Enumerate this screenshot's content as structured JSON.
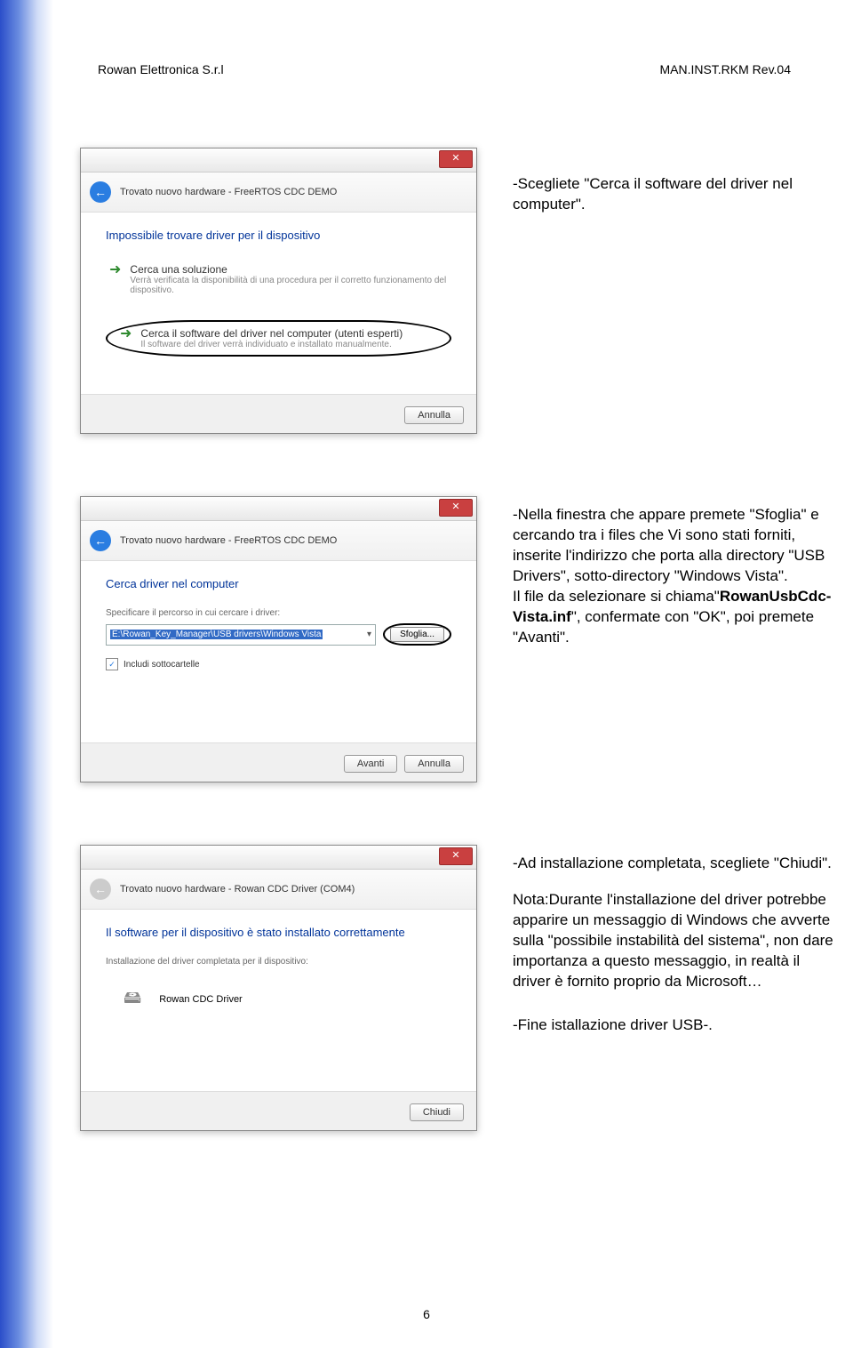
{
  "header": {
    "left": "Rowan Elettronica S.r.l",
    "right": "MAN.INST.RKM    Rev.04"
  },
  "section1": {
    "text": "-Scegliete \"Cerca il software del driver nel computer\".",
    "window": {
      "header_text": "Trovato nuovo hardware - FreeRTOS CDC DEMO",
      "title": "Impossibile trovare driver per il dispositivo",
      "option1_title": "Cerca una soluzione",
      "option1_sub": "Verrà verificata la disponibilità di una procedura per il corretto funzionamento del dispositivo.",
      "option2_title": "Cerca il software del driver nel computer (utenti esperti)",
      "option2_sub": "Il software del driver verrà individuato e installato manualmente.",
      "cancel": "Annulla"
    }
  },
  "section2": {
    "text_p1": "-Nella finestra che appare premete \"Sfoglia\" e  cercando tra i files che Vi sono stati forniti, inserite l'indirizzo che porta alla directory \"USB Drivers\", sotto-directory \"Windows Vista\".",
    "text_p2a": "Il file da selezionare si chiama\"",
    "text_p2b": "RowanUsbCdc-Vista.inf",
    "text_p2c": "\", confermate con \"OK\", poi premete \"Avanti\".",
    "window": {
      "header_text": "Trovato nuovo hardware - FreeRTOS CDC DEMO",
      "title": "Cerca driver nel computer",
      "label_path": "Specificare il percorso in cui cercare i driver:",
      "path_value": "E:\\Rowan_Key_Manager\\USB drivers\\Windows Vista",
      "sfoglia": "Sfoglia...",
      "checkbox": "Includi sottocartelle",
      "avanti": "Avanti",
      "cancel": "Annulla"
    }
  },
  "section3": {
    "text_p1": "-Ad installazione completata, scegliete \"Chiudi\".",
    "text_p2": "Nota:Durante l'installazione del driver potrebbe apparire un messaggio di Windows che avverte sulla \"possibile instabilità del sistema\", non dare importanza a questo messaggio, in realtà il driver è fornito proprio da Microsoft…",
    "text_p3": "-Fine istallazione driver USB-.",
    "window": {
      "header_text": "Trovato nuovo hardware - Rowan CDC Driver (COM4)",
      "title": "Il software per il dispositivo è stato installato correttamente",
      "subtext": "Installazione del driver completata per il dispositivo:",
      "driver_name": "Rowan CDC Driver",
      "chiudi": "Chiudi"
    }
  },
  "page_number": "6"
}
